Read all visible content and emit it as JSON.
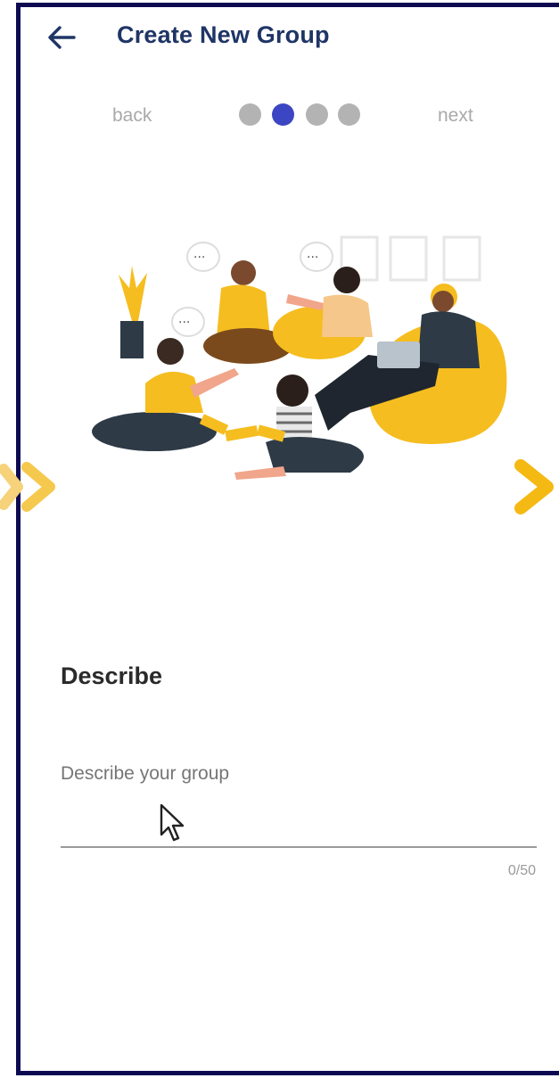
{
  "header": {
    "title": "Create New Group",
    "back_icon": "arrow-left-icon"
  },
  "stepper": {
    "back_label": "back",
    "next_label": "next",
    "total_steps": 4,
    "current_step": 2
  },
  "illustration": {
    "name": "group-discussion-illustration",
    "accent_color": "#f5bd1f",
    "dark_color": "#2e3a46"
  },
  "form": {
    "heading": "Describe",
    "field_label": "Describe your group",
    "value": "",
    "counter": "0/50"
  },
  "overlay": {
    "prev_icon": "chevron-right-icon",
    "next_icon": "chevron-right-icon",
    "color": "#f5b914"
  },
  "colors": {
    "frame": "#0e0a52",
    "title": "#1f3566",
    "active_dot": "#3c46c2",
    "inactive_dot": "#b3b3b3"
  }
}
